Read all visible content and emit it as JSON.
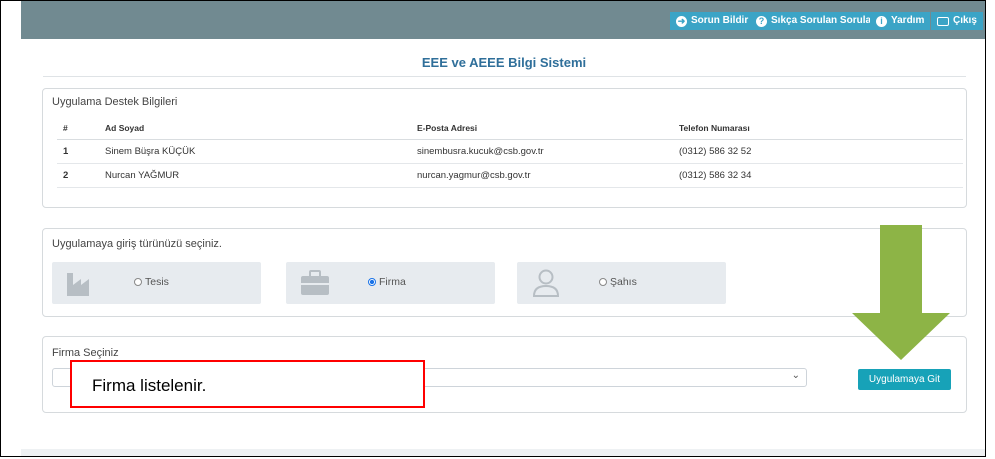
{
  "topbar": {
    "buttons": [
      {
        "label": "Sorun Bildir",
        "icon": "arrow-circle-icon"
      },
      {
        "label": "Sıkça Sorulan Sorular",
        "icon": "question-circle-icon"
      },
      {
        "label": "Yardım",
        "icon": "info-circle-icon"
      },
      {
        "label": "Çıkış",
        "icon": "logout-icon"
      }
    ]
  },
  "page": {
    "title": "EEE ve AEEE Bilgi Sistemi"
  },
  "support": {
    "title": "Uygulama Destek Bilgileri",
    "columns": [
      "#",
      "Ad Soyad",
      "E-Posta Adresi",
      "Telefon Numarası"
    ],
    "rows": [
      [
        "1",
        "Sinem Büşra KÜÇÜK",
        "sinembusra.kucuk@csb.gov.tr",
        "(0312) 586 32 52"
      ],
      [
        "2",
        "Nurcan YAĞMUR",
        "nurcan.yagmur@csb.gov.tr",
        "(0312) 586 32 34"
      ]
    ]
  },
  "login_type": {
    "title": "Uygulamaya giriş türünüzü seçiniz.",
    "options": [
      {
        "label": "Tesis",
        "icon": "factory-icon",
        "selected": false
      },
      {
        "label": "Firma",
        "icon": "briefcase-icon",
        "selected": true
      },
      {
        "label": "Şahıs",
        "icon": "user-icon",
        "selected": false
      }
    ]
  },
  "firm_select": {
    "label": "Firma Seçiniz",
    "value": "",
    "go_label": "Uygulamaya Git"
  },
  "annotation": {
    "text": "Firma listelenir.",
    "box_color": "#ff0000",
    "arrow_color": "#8db446"
  }
}
